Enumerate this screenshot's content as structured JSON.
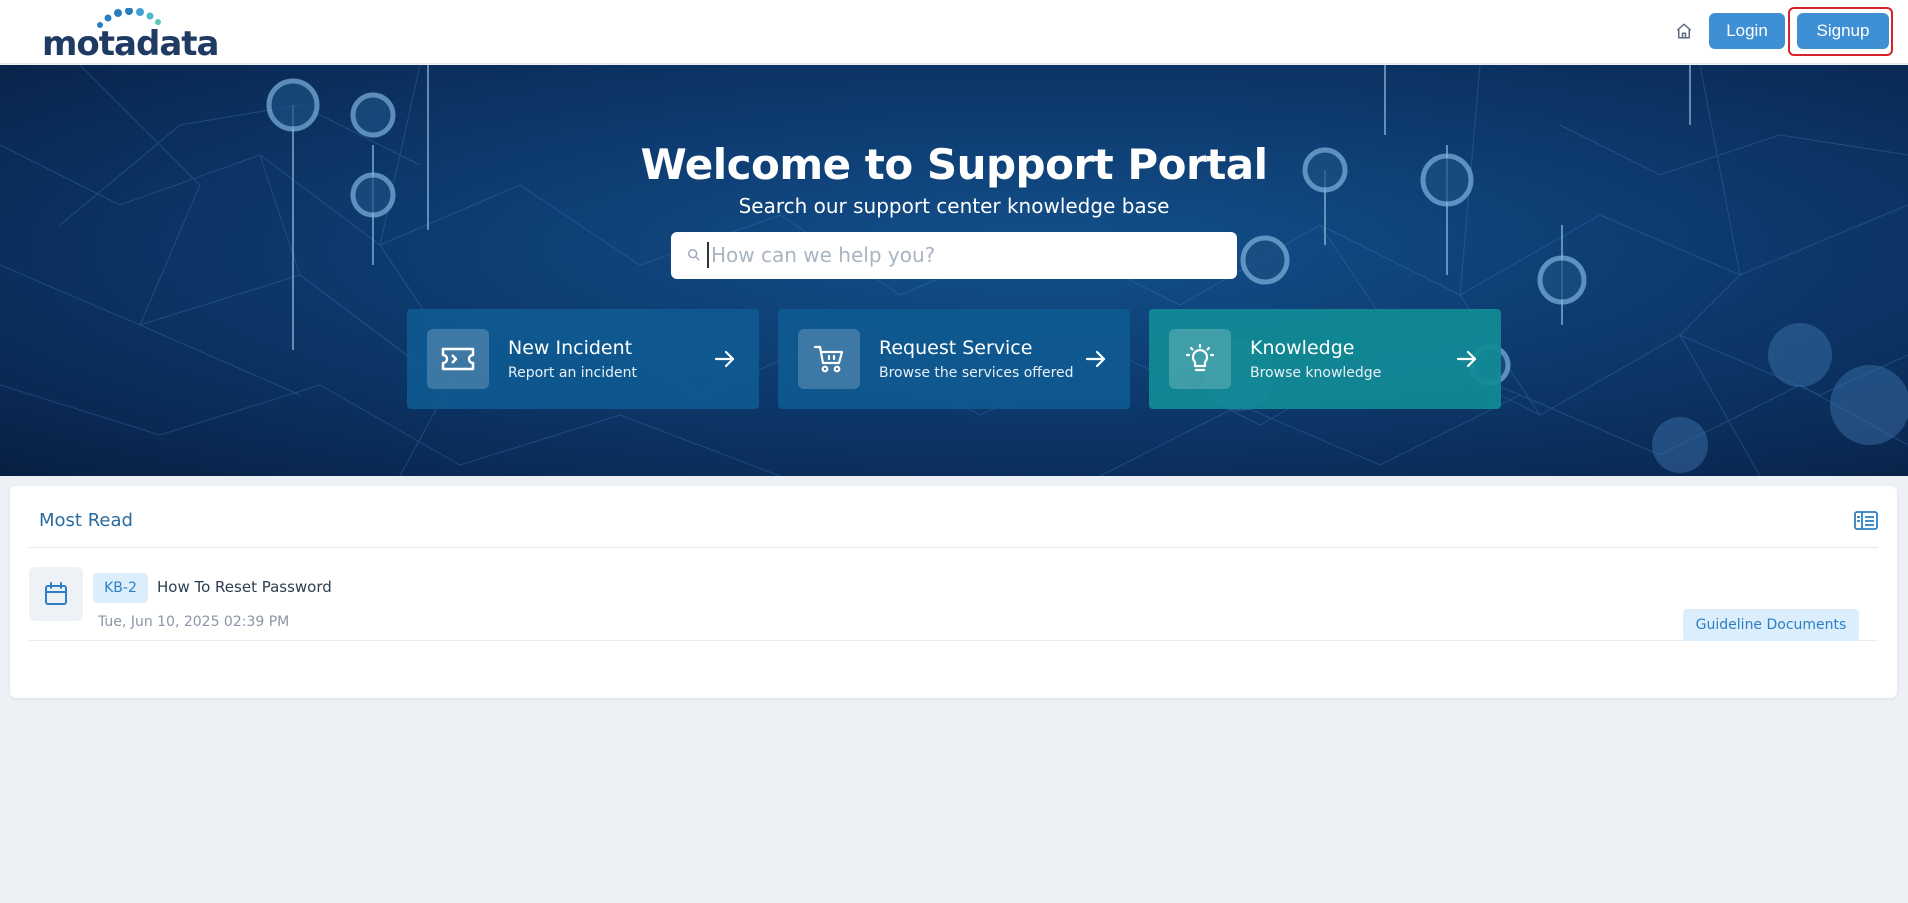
{
  "header": {
    "logo_text": "motadata",
    "login_label": "Login",
    "signup_label": "Signup",
    "icons": [
      "home-icon"
    ]
  },
  "hero": {
    "title": "Welcome to Support Portal",
    "subtitle": "Search our support center knowledge base",
    "search_placeholder": "How can we help you?",
    "cards": [
      {
        "title": "New Incident",
        "desc": "Report an incident",
        "icon": "ticket-icon"
      },
      {
        "title": "Request Service",
        "desc": "Browse the services offered",
        "icon": "cart-icon"
      },
      {
        "title": "Knowledge",
        "desc": "Browse knowledge",
        "icon": "lightbulb-icon"
      }
    ]
  },
  "most_read": {
    "title": "Most Read",
    "icon": "list-view-icon",
    "items": [
      {
        "id": "KB-2",
        "title": "How To Reset Password",
        "date": "Tue, Jun 10, 2025 02:39 PM",
        "category": "Guideline Documents",
        "icon": "calendar-icon"
      }
    ]
  },
  "colors": {
    "primary": "#3f8fd4",
    "highlight": "#d6232b",
    "hero_dark": "#0a2a55",
    "knowledge_card": "#118c96",
    "incident_card": "#0e5a91"
  }
}
